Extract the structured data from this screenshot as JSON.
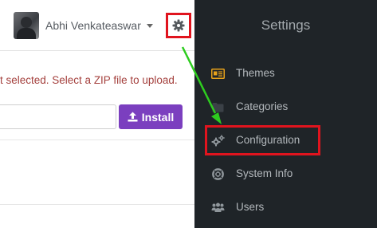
{
  "header": {
    "username": "Abhi Venkateaswar",
    "avatar_icon": "user-avatar",
    "settings_icon": "gear-icon"
  },
  "upload": {
    "error_message": "t selected. Select a ZIP file to upload.",
    "install_label": "Install",
    "install_icon": "upload-icon"
  },
  "settings_panel": {
    "title": "Settings",
    "items": [
      {
        "label": "Themes",
        "icon": "id-card-icon"
      },
      {
        "label": "Categories",
        "icon": "folder-icon"
      },
      {
        "label": "Configuration",
        "icon": "cogs-icon"
      },
      {
        "label": "System Info",
        "icon": "life-ring-icon"
      },
      {
        "label": "Users",
        "icon": "users-icon"
      }
    ]
  },
  "colors": {
    "accent": "#7b3fbf",
    "highlight": "#e0141e",
    "panel_bg": "#1f2428",
    "error_text": "#a4403d",
    "theme_icon": "#e8a21a",
    "annotation_arrow": "#2ecc1f"
  }
}
